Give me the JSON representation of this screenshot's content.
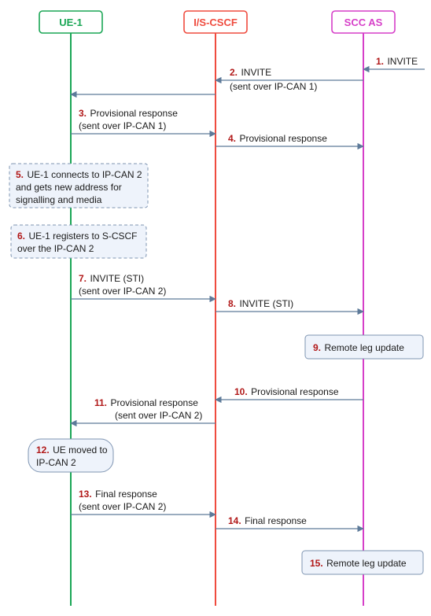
{
  "lanes": {
    "ue": {
      "label": "UE-1",
      "color": "#1aa655"
    },
    "cscf": {
      "label": "I/S-CSCF",
      "color": "#ef4b3e"
    },
    "scc": {
      "label": "SCC AS",
      "color": "#d63fc8"
    }
  },
  "messages": {
    "m1": {
      "num": "1.",
      "text": "INVITE"
    },
    "m2": {
      "num": "2.",
      "text": "INVITE",
      "sub": "(sent over IP-CAN 1)"
    },
    "m3": {
      "num": "3.",
      "text": "Provisional response",
      "sub": "(sent over IP-CAN 1)"
    },
    "m4": {
      "num": "4.",
      "text": "Provisional response"
    },
    "m7": {
      "num": "7.",
      "text": "INVITE (STI)",
      "sub": "(sent over IP-CAN 2)"
    },
    "m8": {
      "num": "8.",
      "text": "INVITE (STI)"
    },
    "m10": {
      "num": "10.",
      "text": "Provisional response"
    },
    "m11": {
      "num": "11.",
      "text": "Provisional response",
      "sub": "(sent over IP-CAN 2)"
    },
    "m13": {
      "num": "13.",
      "text": "Final response",
      "sub": "(sent over IP-CAN 2)"
    },
    "m14": {
      "num": "14.",
      "text": "Final response"
    }
  },
  "notes": {
    "n5": {
      "num": "5.",
      "line1": "UE-1 connects to IP-CAN 2",
      "line2": "and gets new address for",
      "line3": "signalling and media"
    },
    "n6": {
      "num": "6.",
      "line1": "UE-1 registers to S-CSCF",
      "line2": "over the IP-CAN 2"
    },
    "n9": {
      "num": "9.",
      "line1": "Remote leg update"
    },
    "n12": {
      "num": "12.",
      "line1": "UE moved to",
      "line2": "IP-CAN 2"
    },
    "n15": {
      "num": "15.",
      "line1": "Remote leg update"
    }
  }
}
